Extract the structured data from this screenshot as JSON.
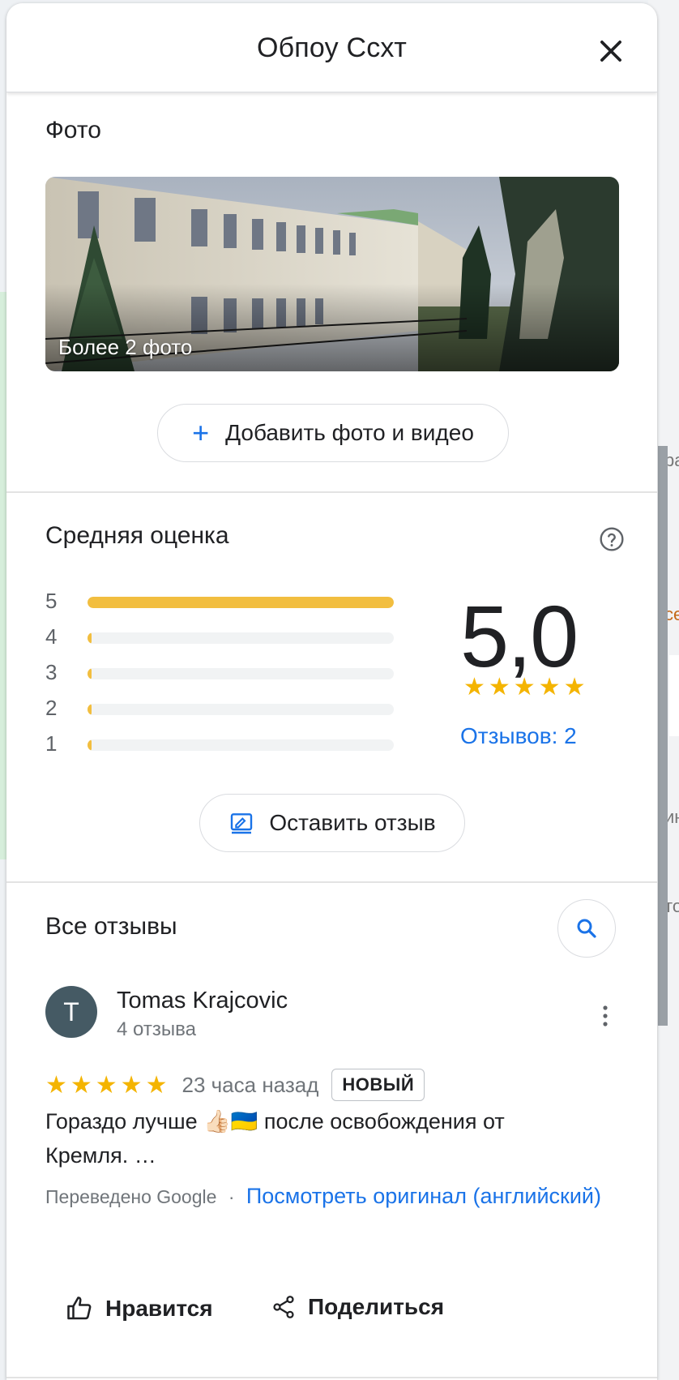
{
  "header": {
    "title": "Обпоу Ссхт"
  },
  "photos": {
    "section_title": "Фото",
    "caption": "Более 2 фото",
    "add_button_label": "Добавить фото и видео"
  },
  "rating": {
    "section_title": "Средняя оценка",
    "distribution": [
      {
        "stars": "5",
        "fraction": 1.0
      },
      {
        "stars": "4",
        "fraction": 0.0
      },
      {
        "stars": "3",
        "fraction": 0.0
      },
      {
        "stars": "2",
        "fraction": 0.0
      },
      {
        "stars": "1",
        "fraction": 0.0
      }
    ],
    "average": "5,0",
    "stars_glyph": "★★★★★",
    "reviews_link": "Отзывов: 2",
    "write_review_label": "Оставить отзыв"
  },
  "reviews": {
    "section_title": "Все отзывы",
    "items": [
      {
        "avatar_letter": "T",
        "name": "Tomas Krajcovic",
        "sub": "4 отзыва",
        "stars_glyph": "★★★★★",
        "time": "23 часа назад",
        "badge": "НОВЫЙ",
        "text_line1": "Гораздо лучше 👍🏻🇺🇦 после освобождения от",
        "text_line2": "Кремля. …",
        "translated_by": "Переведено Google",
        "separator": "·",
        "original_link": "Посмотреть оригинал (английский)",
        "like_label": "Нравится",
        "share_label": "Поделиться"
      }
    ]
  },
  "map_fragments": {
    "right_top": "ра",
    "right_orange": "се",
    "right_mid": "ин",
    "right_low": "то"
  },
  "colors": {
    "accent_blue": "#1a73e8",
    "star_yellow": "#f4b400",
    "bar_yellow": "#f2be3f",
    "avatar_bg": "#455a64"
  }
}
